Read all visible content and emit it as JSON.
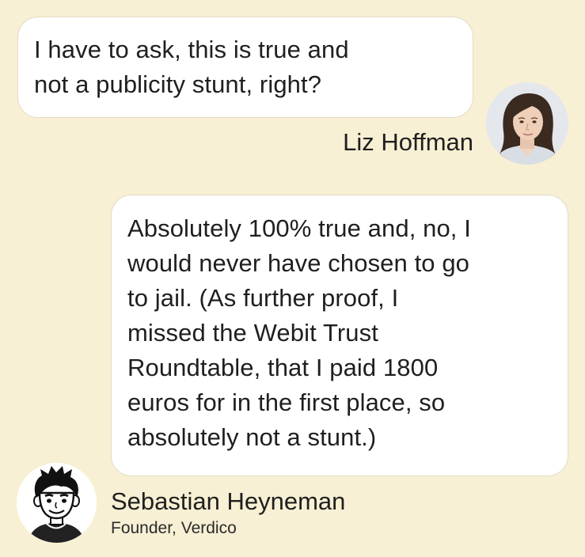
{
  "conversation": {
    "question": {
      "lines": [
        "I have to ask, this is true and",
        "not a publicity stunt, right?"
      ],
      "author": "Liz Hoffman"
    },
    "answer": {
      "lines": [
        "Absolutely 100% true and, no, I",
        "would never have chosen to go",
        "to jail. (As further proof, I",
        "missed the Webit Trust",
        "Roundtable, that I paid 1800",
        "euros for in the first place, so",
        "absolutely not a stunt.)"
      ],
      "author": "Sebastian Heyneman",
      "author_title": "Founder, Verdico"
    }
  },
  "colors": {
    "background": "#f8f0d4",
    "bubble": "#ffffff",
    "bubble_border": "#e3dcc6",
    "text": "#1f1f1f"
  },
  "icons": {
    "liz_avatar": "photo-portrait-avatar",
    "sebastian_avatar": "cartoon-portrait-avatar"
  }
}
